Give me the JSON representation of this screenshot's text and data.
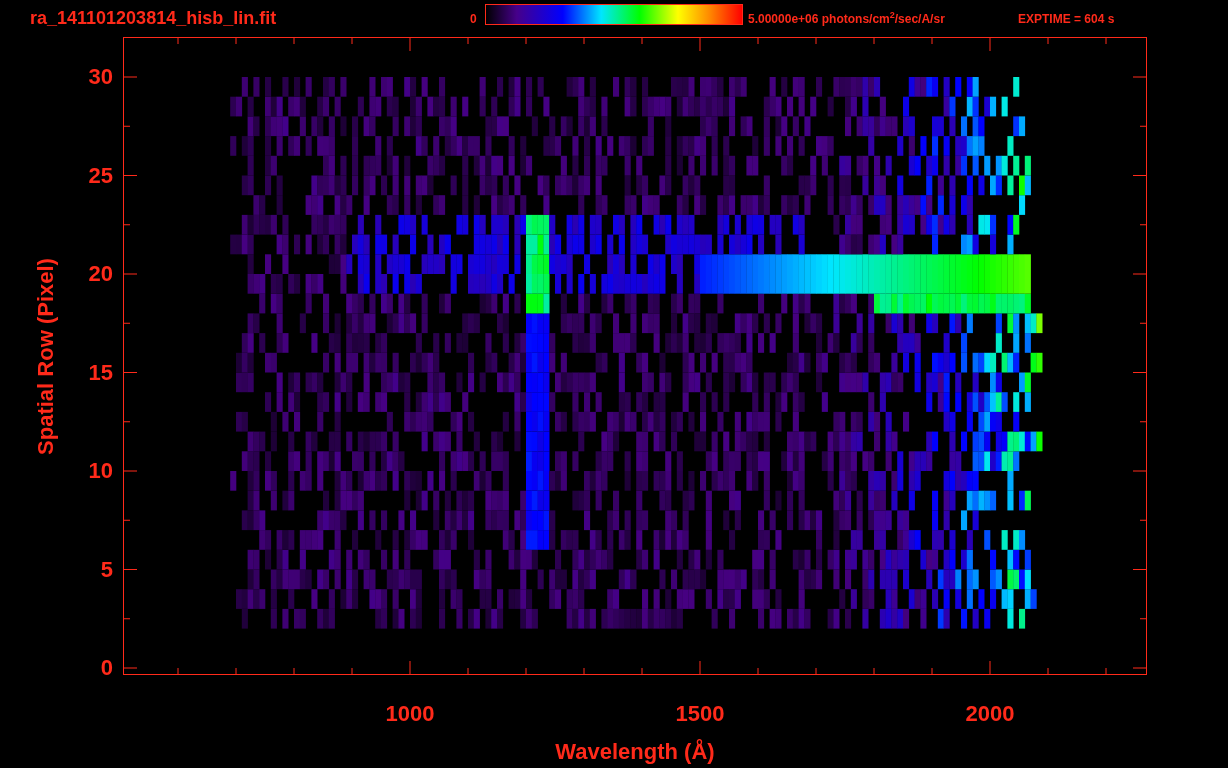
{
  "title": "ra_141101203814_hisb_lin.fit",
  "colorbar": {
    "min_label": "0",
    "max_label": "5.00000e+06 photons/cm$^{2}$/sec/A/sr"
  },
  "exptime": "EXPTIME = 604 s",
  "y_axis": {
    "label": "Spatial Row (Pixel)",
    "ticks": [
      "30",
      "25",
      "20",
      "15",
      "10",
      "5",
      "0"
    ]
  },
  "x_axis": {
    "label": "Wavelength (Å)",
    "ticks": [
      "1000",
      "1500",
      "2000"
    ]
  }
}
